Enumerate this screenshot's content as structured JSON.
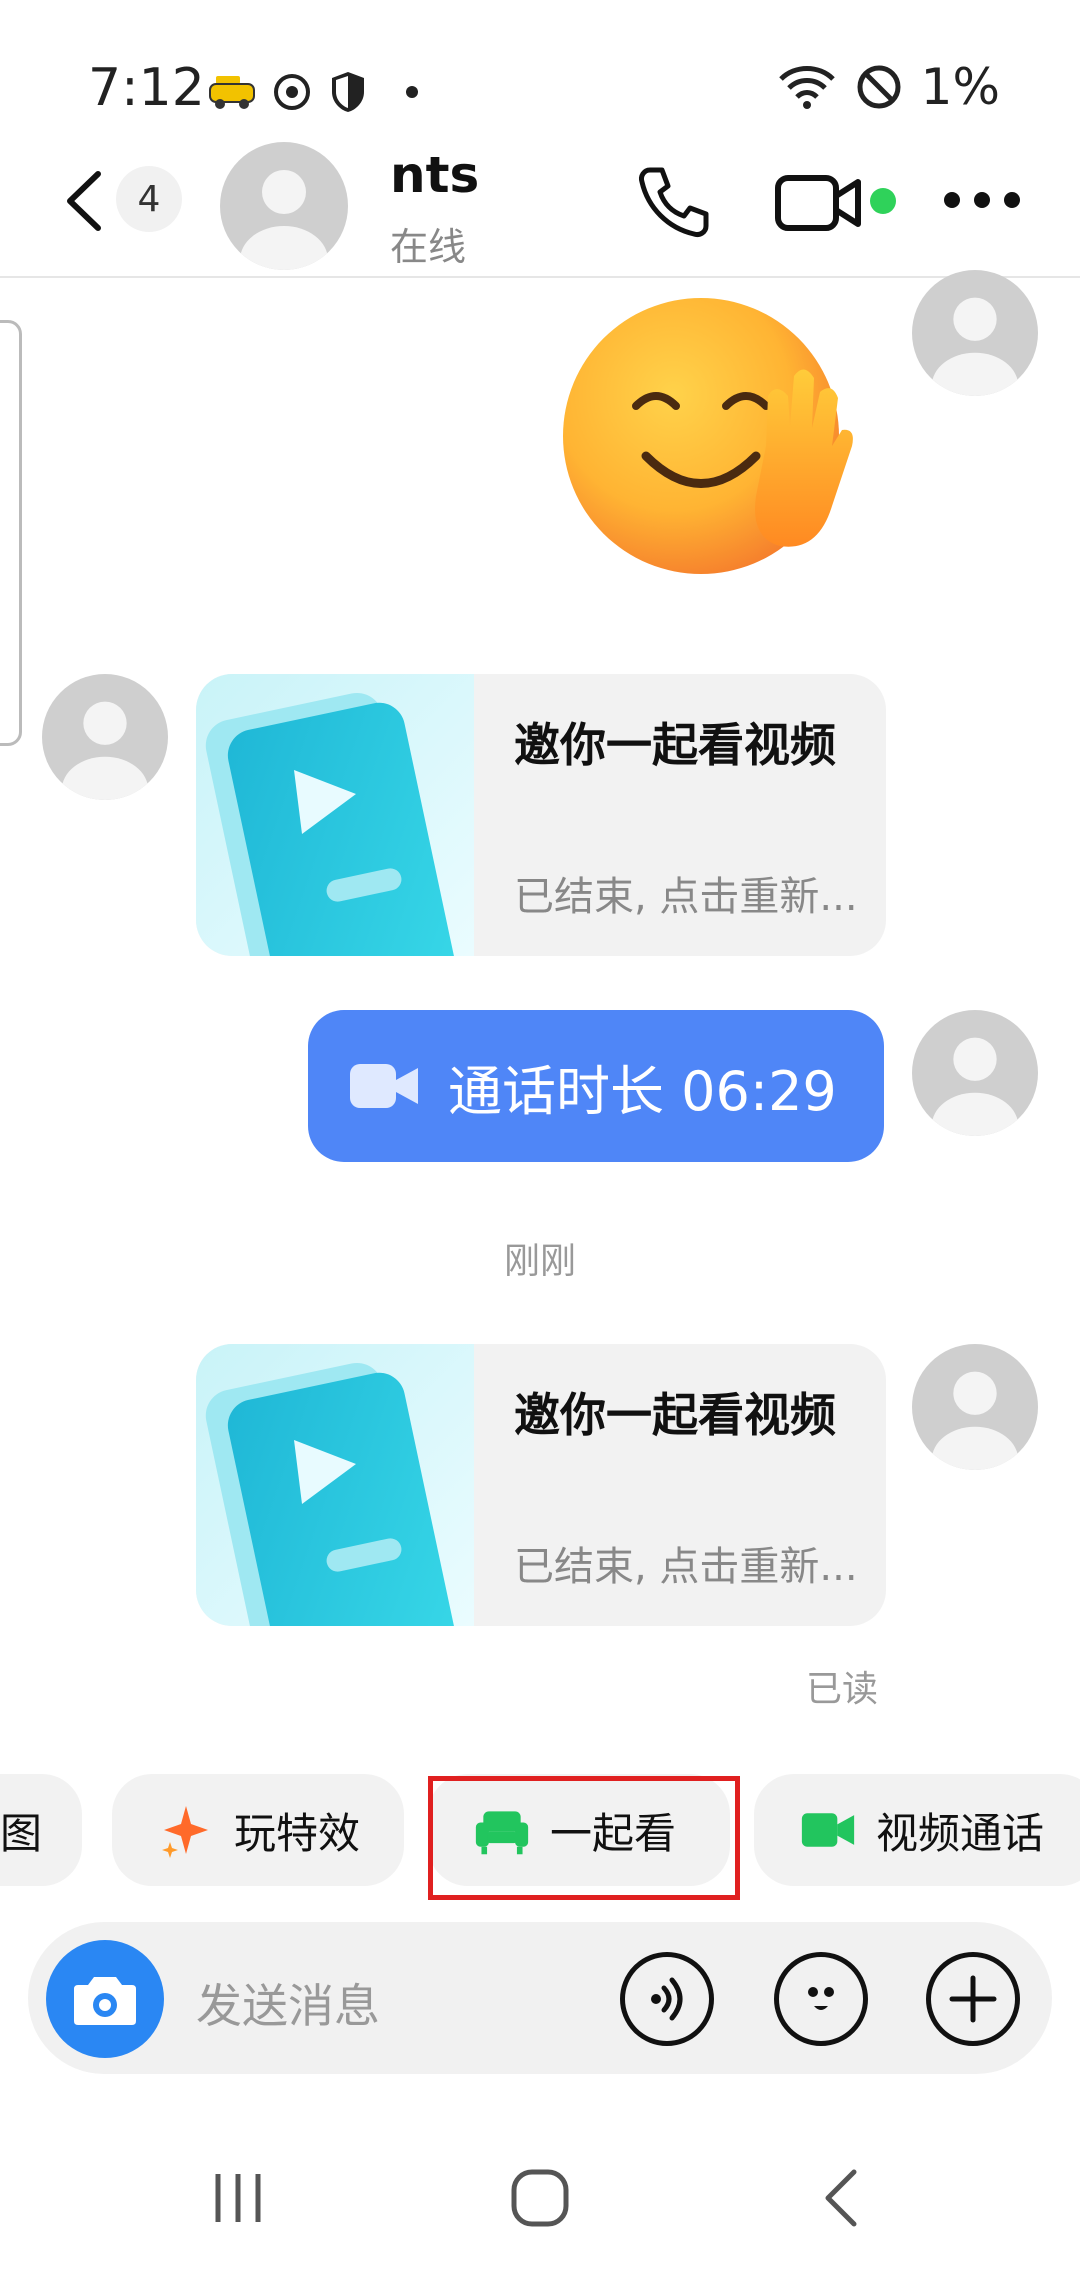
{
  "status_bar": {
    "time": "7:12",
    "icons": [
      "taxi-icon",
      "sync-icon",
      "shield-icon",
      "dot-icon"
    ],
    "right_icons": [
      "wifi-icon",
      "no-disturb-icon"
    ],
    "battery": "1%"
  },
  "header": {
    "unread_count": "4",
    "contact_name": "nts",
    "contact_status": "在线",
    "online_dot_color": "#2fd25a"
  },
  "messages": [
    {
      "type": "sticker",
      "side": "right",
      "emoji": "waving-smile"
    },
    {
      "type": "card",
      "side": "left",
      "title": "邀你一起看视频",
      "subtitle": "已结束, 点击重新..."
    },
    {
      "type": "call",
      "side": "right",
      "text": "通话时长 06:29"
    },
    {
      "type": "divider",
      "text": "刚刚"
    },
    {
      "type": "card",
      "side": "right",
      "title": "邀你一起看视频",
      "subtitle": "已结束, 点击重新..."
    }
  ],
  "read_receipt": "已读",
  "chips": {
    "partial_label": "图",
    "effects_label": "玩特效",
    "watch_together_label": "一起看",
    "video_call_label": "视频通话"
  },
  "input": {
    "placeholder": "发送消息"
  },
  "colors": {
    "accent_blue": "#4f86f7",
    "camera_blue": "#2a87f3",
    "highlight_red": "#e02020",
    "green": "#22c55e"
  }
}
